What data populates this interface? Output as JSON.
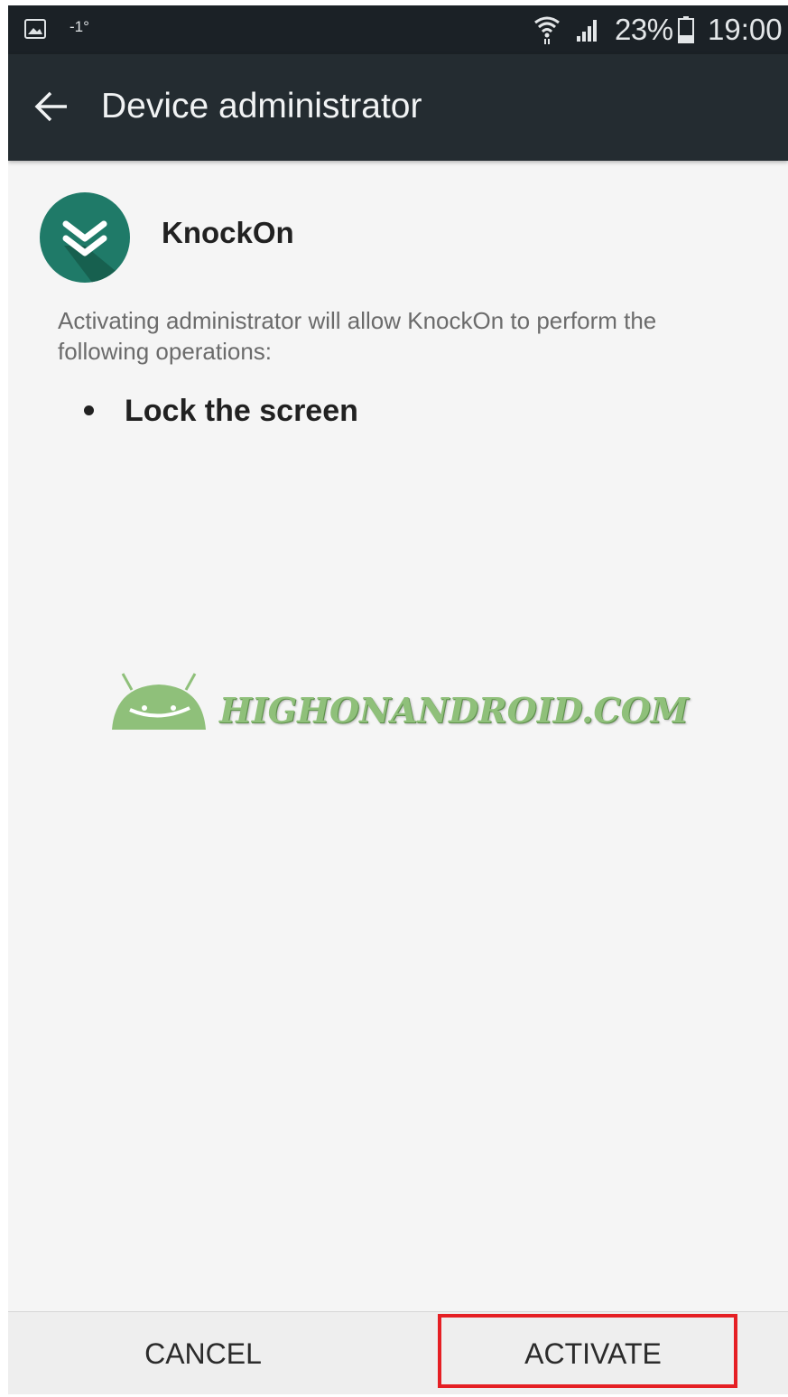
{
  "status_bar": {
    "temperature": "-1°",
    "battery_percent": "23%",
    "time": "19:00",
    "icons": [
      "gallery-icon",
      "wifi-icon",
      "signal-icon",
      "battery-icon"
    ]
  },
  "app_bar": {
    "title": "Device administrator",
    "back_icon": "arrow-back-icon"
  },
  "app": {
    "name": "KnockOn",
    "icon": "double-chevron-down-icon",
    "icon_color": "#1f7a68"
  },
  "description": "Activating administrator will allow KnockOn to perform the following operations:",
  "operations": [
    "Lock the screen"
  ],
  "watermark": {
    "text": "HIGHONANDROID.COM",
    "color": "#8fc07a"
  },
  "buttons": {
    "cancel": "CANCEL",
    "activate": "ACTIVATE"
  },
  "highlight_color": "#e51f24"
}
